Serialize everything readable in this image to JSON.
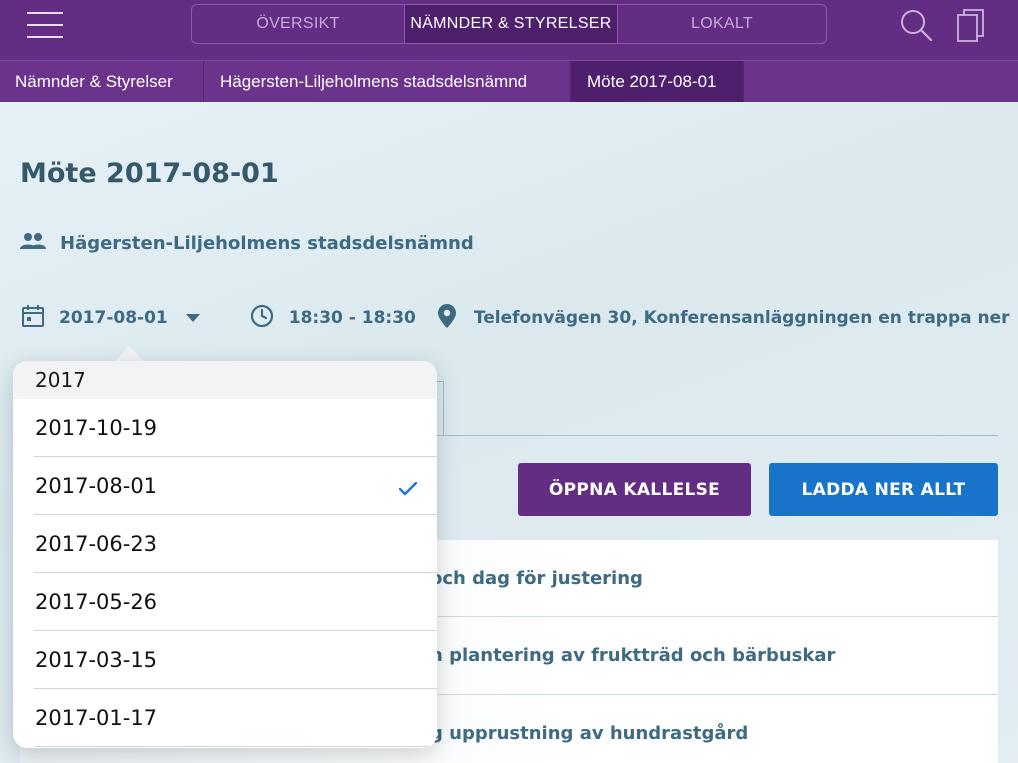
{
  "topbar": {
    "tabs": [
      {
        "label": "ÖVERSIKT"
      },
      {
        "label": "NÄMNDER & STYRELSER"
      },
      {
        "label": "LOKALT"
      }
    ],
    "active_tab": "NÄMNDER & STYRELSER"
  },
  "breadcrumb": {
    "items": [
      {
        "label": "Nämnder & Styrelser"
      },
      {
        "label": "Hägersten-Liljeholmens stadsdelsnämnd"
      },
      {
        "label": "Möte 2017-08-01"
      }
    ]
  },
  "meeting": {
    "title": "Möte 2017-08-01",
    "organization": "Hägersten-Liljeholmens stadsdelsnämnd",
    "date": "2017-08-01",
    "time": "18:30 - 18:30",
    "location": "Telefonvägen 30, Konferensanläggningen en trappa ner"
  },
  "actions": {
    "open_notice": "ÖPPNA KALLELSE",
    "download_all": "LADDA NER ALLT"
  },
  "agenda": {
    "items": [
      {
        "visible_text": "och dag för justering"
      },
      {
        "visible_text": "n plantering av fruktträd och bärbuskar"
      },
      {
        "visible_text": "g upprustning av hundrastgård"
      }
    ]
  },
  "date_picker": {
    "year_header": "2017",
    "options": [
      {
        "label": "2017-10-19",
        "selected": false
      },
      {
        "label": "2017-08-01",
        "selected": true
      },
      {
        "label": "2017-06-23",
        "selected": false
      },
      {
        "label": "2017-05-26",
        "selected": false
      },
      {
        "label": "2017-03-15",
        "selected": false
      },
      {
        "label": "2017-01-17",
        "selected": false
      }
    ]
  },
  "icons": {
    "menu": "hamburger-icon",
    "search": "search-icon",
    "pages": "pages-icon",
    "people": "people-icon",
    "calendar": "calendar-icon",
    "dropdown": "caret-down-icon",
    "clock": "clock-icon",
    "location": "location-pin-icon",
    "check": "checkmark-icon"
  },
  "colors": {
    "brand_purple": "#622d82",
    "action_blue": "#1873c9",
    "text_blue": "#3e6a82",
    "check_blue": "#1a73e8"
  }
}
